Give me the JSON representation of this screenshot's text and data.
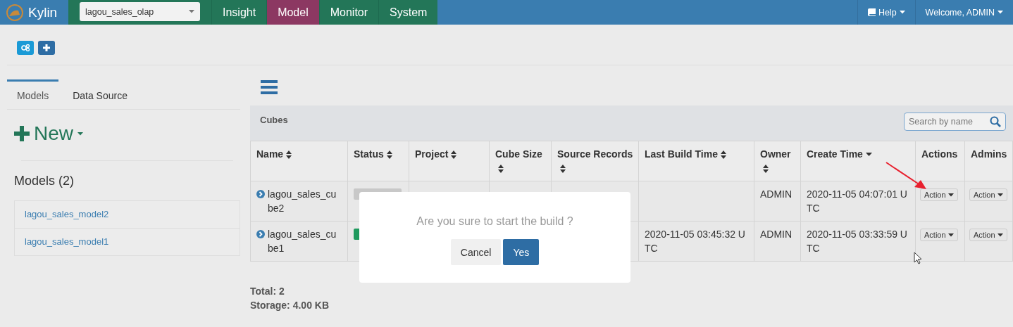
{
  "navbar": {
    "brand": "Kylin",
    "project_select": {
      "value": "lagou_sales_olap"
    },
    "tabs": [
      {
        "label": "Insight",
        "selected": false
      },
      {
        "label": "Model",
        "selected": true
      },
      {
        "label": "Monitor",
        "selected": false
      },
      {
        "label": "System",
        "selected": false
      }
    ],
    "help": "Help",
    "user": "Welcome, ADMIN"
  },
  "sidebar": {
    "tabs": [
      {
        "label": "Models",
        "selected": true
      },
      {
        "label": "Data Source",
        "selected": false
      }
    ],
    "new_button": "New",
    "models_title": "Models (2)",
    "models": [
      "lagou_sales_model2",
      "lagou_sales_model1"
    ]
  },
  "cubes": {
    "title": "Cubes",
    "search": {
      "placeholder": "Search by name"
    },
    "columns": [
      {
        "label": "Name",
        "kind": "sortable"
      },
      {
        "label": "Status",
        "kind": "sortable"
      },
      {
        "label": "Project",
        "kind": "sortable"
      },
      {
        "label": "Cube Size",
        "kind": "sortable"
      },
      {
        "label": "Source Records",
        "kind": "sortable"
      },
      {
        "label": "Last Build Time",
        "kind": "sortable"
      },
      {
        "label": "Owner",
        "kind": "sortable"
      },
      {
        "label": "Create Time",
        "kind": "sorted"
      },
      {
        "label": "Actions",
        "kind": "plain"
      },
      {
        "label": "Admins",
        "kind": "plain"
      }
    ],
    "rows": [
      {
        "name": "lagou_sales_cube2",
        "status_badge": {
          "color": "#c8c8c8"
        },
        "owner": "ADMIN",
        "create_time": "2020-11-05 04:07:01 UTC",
        "actions": "Action",
        "admins": "Action"
      },
      {
        "name": "lagou_sales_cube1",
        "status_badge": {
          "color": "#1f9a5e"
        },
        "last_build_time": "2020-11-05 03:45:32 UTC",
        "owner": "ADMIN",
        "create_time": "2020-11-05 03:33:59 UTC",
        "actions": "Action",
        "admins": "Action"
      }
    ],
    "total": "Total: 2",
    "storage": "Storage: 4.00 KB"
  },
  "dialog": {
    "message": "Are you sure to start the build ?",
    "buttons": [
      {
        "label": "Cancel",
        "kind": "default"
      },
      {
        "label": "Yes",
        "kind": "primary"
      }
    ]
  }
}
